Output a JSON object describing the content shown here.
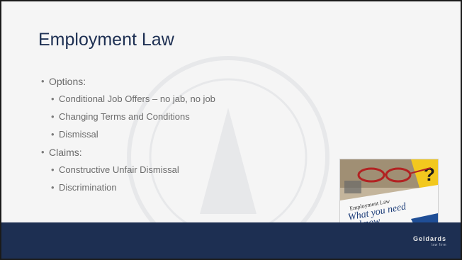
{
  "slide": {
    "title": "Employment Law",
    "bullets": [
      {
        "level": 1,
        "text": "Options:"
      },
      {
        "level": 2,
        "text": "Conditional Job Offers – no jab, no job"
      },
      {
        "level": 2,
        "text": "Changing Terms and Conditions"
      },
      {
        "level": 2,
        "text": "Dismissal"
      },
      {
        "level": 1,
        "text": "Claims:"
      },
      {
        "level": 2,
        "text": "Constructive Unfair Dismissal"
      },
      {
        "level": 2,
        "text": "Discrimination"
      }
    ],
    "bullet_char": "•"
  },
  "image": {
    "line1": "Employment Law",
    "line2": "What you need",
    "line3": "to know"
  },
  "brand": {
    "name": "Geldards",
    "tagline": "law firm"
  },
  "colors": {
    "footer": "#1d2f52",
    "title": "#1d2f52",
    "body_text": "#6b6b6b",
    "sign_yellow": "#f2c81e"
  }
}
